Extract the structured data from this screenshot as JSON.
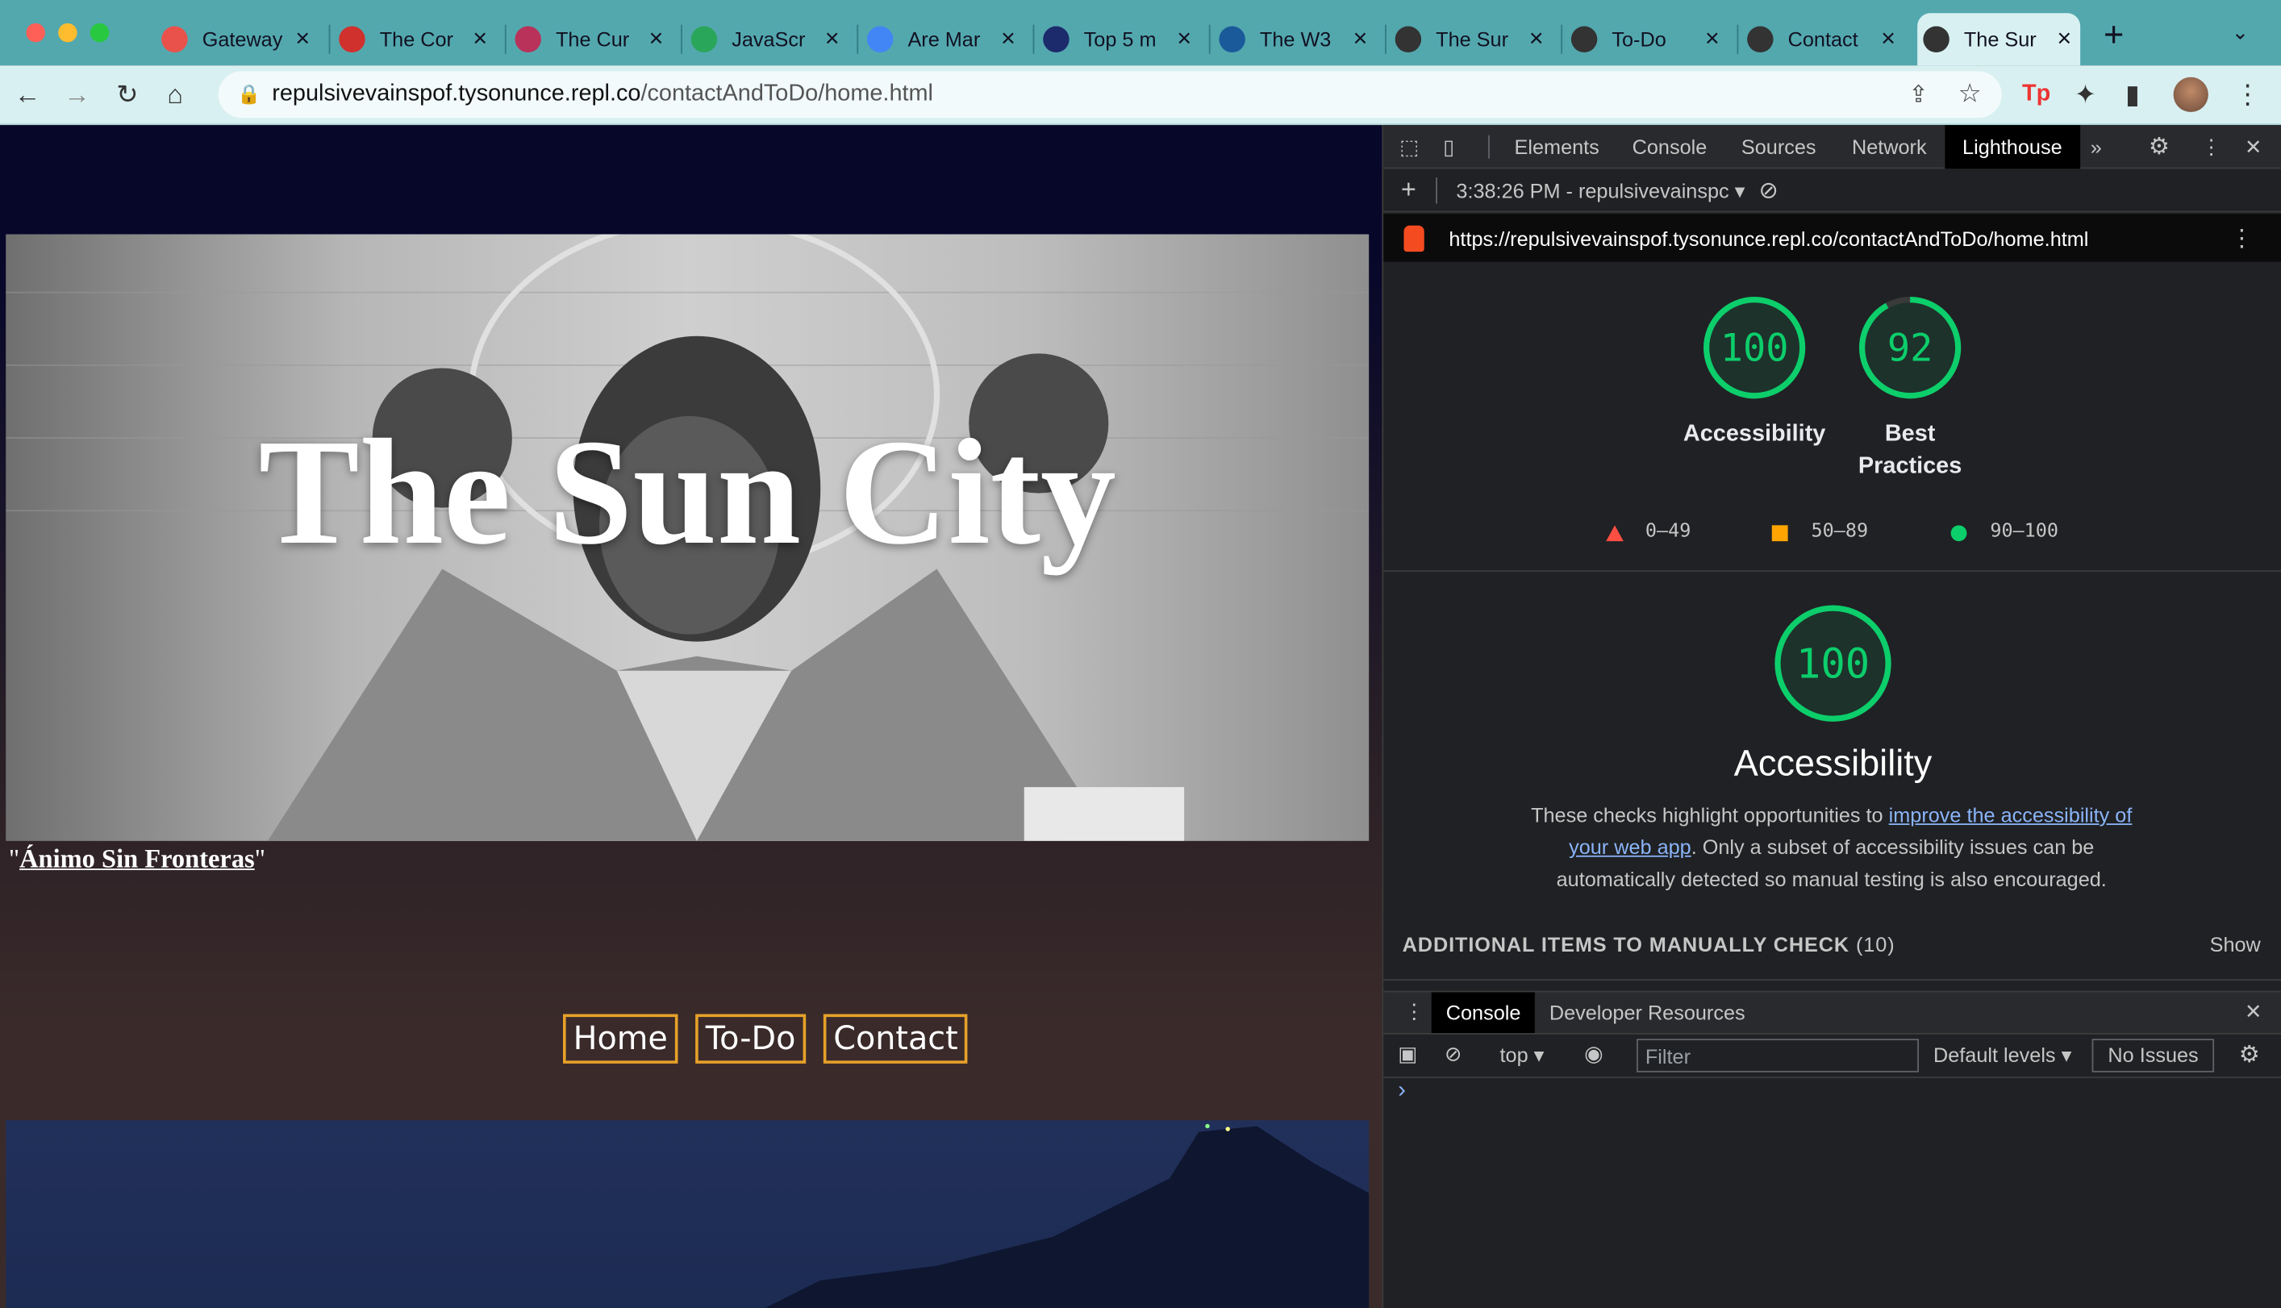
{
  "browser": {
    "tabs": [
      {
        "title": "Gateway",
        "icon": "gateway-icon",
        "color": "#e9524b"
      },
      {
        "title": "The Cor",
        "icon": "corona-icon",
        "color": "#d0312d"
      },
      {
        "title": "The Cur",
        "icon": "rv-icon",
        "color": "#b8325a"
      },
      {
        "title": "JavaScr",
        "icon": "w-icon",
        "color": "#2aa65a"
      },
      {
        "title": "Are Mar",
        "icon": "google-icon",
        "color": "#4285f4"
      },
      {
        "title": "Top 5 m",
        "icon": "a-icon",
        "color": "#1c2b6b"
      },
      {
        "title": "The W3",
        "icon": "w3c-icon",
        "color": "#1a5a9a"
      },
      {
        "title": "The Sur",
        "icon": "globe-icon",
        "color": "#333333"
      },
      {
        "title": "To-Do",
        "icon": "globe-icon",
        "color": "#333333"
      },
      {
        "title": "Contact",
        "icon": "globe-icon",
        "color": "#333333"
      },
      {
        "title": "The Sur",
        "icon": "globe-icon",
        "color": "#333333"
      }
    ],
    "url_host": "repulsivevainspof.tysonunce.repl.co",
    "url_path": "/contactAndToDo/home.html"
  },
  "page": {
    "title": "The Sun City",
    "tagline_quote_open": "\"",
    "tagline_link": "Ánimo Sin Fronteras",
    "tagline_quote_close": "\"",
    "nav": [
      "Home",
      "To-Do",
      "Contact"
    ],
    "nav_border_color": "#e6a129"
  },
  "devtools": {
    "tabs": [
      "Elements",
      "Console",
      "Sources",
      "Network",
      "Lighthouse"
    ],
    "report_time": "3:38:26 PM - repulsivevainspc",
    "report_url": "https://repulsivevainspof.tysonunce.repl.co/contactAndToDo/home.html",
    "scores": [
      {
        "label": "Accessibility",
        "value": 100
      },
      {
        "label": "Best Practices",
        "value": 92
      }
    ],
    "legend": [
      {
        "range": "0–49",
        "color": "#ff4e42"
      },
      {
        "range": "50–89",
        "color": "#ffa400"
      },
      {
        "range": "90–100",
        "color": "#0cce6b"
      }
    ],
    "main_score": 100,
    "main_title": "Accessibility",
    "desc_before": "These checks highlight opportunities to ",
    "desc_link": "improve the accessibility of your web app",
    "desc_after": ". Only a subset of accessibility issues can be automatically detected so manual testing is also encouraged.",
    "manual_label": "ADDITIONAL ITEMS TO MANUALLY CHECK",
    "manual_count": "(10)",
    "show_label": "Show",
    "drawer_tabs": [
      "Console",
      "Developer Resources"
    ],
    "context": "top",
    "filter_placeholder": "Filter",
    "levels": "Default levels",
    "issues": "No Issues",
    "prompt": "›"
  }
}
